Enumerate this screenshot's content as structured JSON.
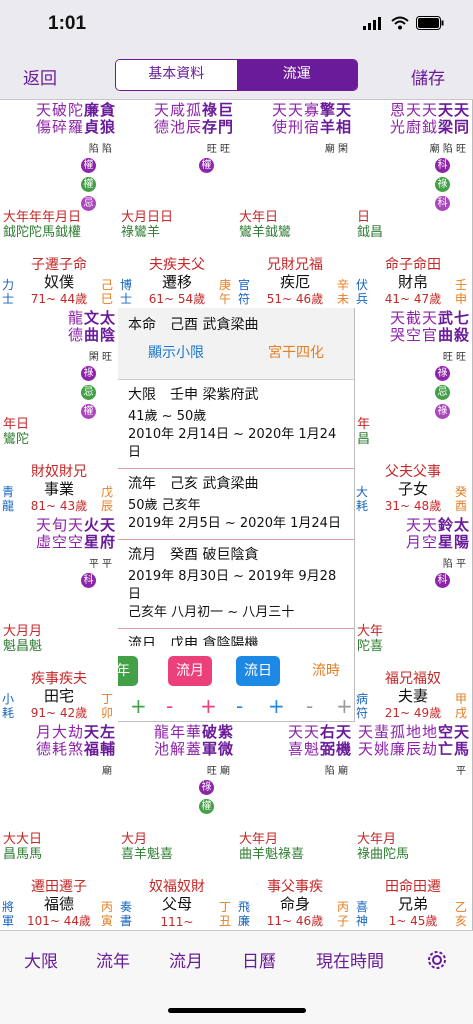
{
  "status": {
    "time": "1:01"
  },
  "nav": {
    "back": "返回",
    "seg": [
      "基本資料",
      "流運"
    ],
    "save": "儲存"
  },
  "center": {
    "top_line": "本命　己酉 武貪梁曲",
    "btn_small": "顯示小限",
    "btn_gan": "宮干四化",
    "daxian_h": "大限　壬申 梁紫府武",
    "daxian_age": "41歲 ~ 50歲",
    "daxian_date": "2010年 2月14日 ~ 2020年 1月24日",
    "liunian_h": "流年　己亥 武貪梁曲",
    "liunian_age": "50歲 己亥年",
    "liunian_date": "2019年 2月5日 ~ 2020年 1月24日",
    "liuyue_h": "流月　癸酉 破巨陰貪",
    "liuyue_date": "2019年 8月30日 ~ 2019年 9月28日",
    "liuyue_lunar": "己亥年 八月初一 ~ 八月三十",
    "liuri_h": "流日　戊申 貪陰陽機",
    "pills": [
      "年",
      "流月",
      "流日",
      "流時"
    ],
    "plus": "+",
    "minus": "-"
  },
  "tabs": [
    "大限",
    "流年",
    "流月",
    "日曆",
    "現在時間"
  ],
  "cells": [
    {
      "id": "c0",
      "stars": [
        "廉",
        "貪",
        "狼",
        "陀",
        "羅",
        "破",
        "碎",
        "天",
        "傷"
      ],
      "main": "廉貪",
      "star_cols": [
        [
          "貪",
          "狼"
        ],
        [
          "廉",
          "貞"
        ],
        [
          "陀",
          "羅"
        ],
        [
          "破",
          "碎"
        ],
        [
          "天",
          "傷"
        ]
      ],
      "bright": "陷 陷",
      "hua": [
        "權",
        "權",
        "忌"
      ],
      "lvl": [
        "大年年年月日",
        "鉞陀陀馬鉞權"
      ],
      "life": "子遷子命",
      "name": "奴僕",
      "ages": "71~ 44歲",
      "lb": "力士",
      "rb": "己巳"
    },
    {
      "id": "c1",
      "star_cols": [
        [
          "巨",
          "門"
        ],
        [
          "祿",
          "存"
        ],
        [
          "孤",
          "辰"
        ],
        [
          "咸",
          "池"
        ],
        [
          "天",
          "德"
        ]
      ],
      "bright": "旺 旺",
      "hua": [
        "權"
      ],
      "lvl": [
        "大月日日",
        "祿鸞羊"
      ],
      "life": "夫疾夫父",
      "name": "遷移",
      "ages": "61~ 54歲",
      "lb": "博士",
      "rb": "庚午"
    },
    {
      "id": "c2",
      "star_cols": [
        [
          "天",
          "相"
        ],
        [
          "擎",
          "羊"
        ],
        [
          "寡",
          "宿"
        ],
        [
          "天",
          "刑"
        ],
        [
          "天",
          "使"
        ]
      ],
      "bright": "廟 閑",
      "hua": [],
      "lvl": [
        "大年日",
        "鸞羊鉞鸞"
      ],
      "life": "兄財兄福",
      "name": "疾厄",
      "ages": "51~ 46歲",
      "lb": "官符",
      "rb": "辛未"
    },
    {
      "id": "c3",
      "star_cols": [
        [
          "天",
          "同"
        ],
        [
          "天",
          "梁"
        ],
        [
          "天",
          "鉞"
        ],
        [
          "天",
          "廚"
        ],
        [
          "恩",
          "光"
        ]
      ],
      "bright": "廟 陷 旺",
      "hua": [
        "科",
        "祿",
        "科"
      ],
      "lvl": [
        "日",
        "鉞昌"
      ],
      "life": "命子命田",
      "name": "財帛",
      "ages": "41~ 47歲",
      "lb": "伏兵",
      "rb": "壬申"
    },
    {
      "id": "c4",
      "star_cols": [
        [
          "太",
          "陰"
        ],
        [
          "文",
          "曲"
        ],
        [
          "龍",
          "德"
        ]
      ],
      "bright": "閑 旺",
      "hua": [
        "祿",
        "忌",
        "權"
      ],
      "lvl": [
        "年日",
        "鸞陀"
      ],
      "life": "財奴財兄",
      "name": "事業",
      "ages": "81~ 43歲",
      "lb": "青龍",
      "rb": "戊辰"
    },
    {
      "id": "c5",
      "star_cols": [
        [
          "七",
          "殺"
        ],
        [
          "武",
          "曲"
        ],
        [
          "天",
          "官"
        ],
        [
          "截",
          "空"
        ],
        [
          "天",
          "哭"
        ]
      ],
      "bright": "旺 旺",
      "hua": [
        "祿",
        "忌",
        "祿"
      ],
      "lvl": [
        "年",
        "昌"
      ],
      "life": "父夫父事",
      "name": "子女",
      "ages": "31~ 48歲",
      "lb": "大耗",
      "rb": "癸酉"
    },
    {
      "id": "c6",
      "star_cols": [
        [
          "天",
          "府"
        ],
        [
          "火",
          "星"
        ],
        [
          "天",
          "空"
        ],
        [
          "旬",
          "空"
        ],
        [
          "天",
          "虛"
        ]
      ],
      "bright": "平 平",
      "hua": [
        "科"
      ],
      "lvl": [
        "大月月",
        "魁昌魁"
      ],
      "life": "疾事疾夫",
      "name": "田宅",
      "ages": "91~ 42歲",
      "lb": "小耗",
      "rb": "丁卯"
    },
    {
      "id": "c7",
      "star_cols": [
        [
          "太",
          "陽"
        ],
        [
          "鈴",
          "星"
        ],
        [
          "天",
          "空"
        ],
        [
          "天",
          "月"
        ]
      ],
      "bright": "陷 平",
      "hua": [
        "科"
      ],
      "lvl": [
        "大年",
        "陀喜"
      ],
      "life": "福兄福奴",
      "name": "夫妻",
      "ages": "21~ 49歲",
      "lb": "病符",
      "rb": "甲戌"
    },
    {
      "id": "c8",
      "star_cols": [
        [
          "左",
          "輔"
        ],
        [
          "天",
          "福"
        ],
        [
          "劫",
          "煞"
        ],
        [
          "大",
          "耗"
        ],
        [
          "月",
          "德"
        ]
      ],
      "bright": "廟",
      "hua": [],
      "lvl": [
        "大大日",
        "昌馬馬"
      ],
      "life": "遷田遷子",
      "name": "福德",
      "ages": "101~ 44歲",
      "lb": "將軍",
      "rb": "丙寅"
    },
    {
      "id": "c9",
      "star_cols": [
        [
          "紫",
          "微"
        ],
        [
          "破",
          "軍"
        ],
        [
          "華",
          "蓋"
        ],
        [
          "年",
          "解"
        ],
        [
          "龍",
          "池"
        ]
      ],
      "bright": "旺 廟",
      "hua": [
        "祿",
        "權"
      ],
      "lvl": [
        "大月",
        "喜羊魁喜"
      ],
      "life": "奴福奴財",
      "name": "父母",
      "ages": "111~",
      "lb": "奏書",
      "rb": "丁丑"
    },
    {
      "id": "c10",
      "star_cols": [
        [
          "天",
          "機"
        ],
        [
          "右",
          "弼"
        ],
        [
          "天",
          "魁"
        ],
        [
          "天",
          "喜"
        ]
      ],
      "bright": "陷 廟",
      "hua": [],
      "lvl": [
        "大年月",
        "曲羊魁祿喜"
      ],
      "life": "事父事疾",
      "name": "命身",
      "ages": "11~ 46歲",
      "lb": "飛廉",
      "rb": "丙子"
    },
    {
      "id": "c11",
      "star_cols": [
        [
          "天",
          "馬"
        ],
        [
          "空",
          "亡"
        ],
        [
          "地",
          "劫"
        ],
        [
          "地",
          "辰"
        ],
        [
          "孤",
          "廉"
        ],
        [
          "蜚",
          "姚"
        ],
        [
          "天",
          "天"
        ]
      ],
      "bright": "平",
      "hua": [],
      "lvl": [
        "大年月",
        "祿曲陀馬"
      ],
      "life": "田命田遷",
      "name": "兄弟",
      "ages": "1~ 45歲",
      "lb": "喜神",
      "rb": "乙亥"
    }
  ]
}
